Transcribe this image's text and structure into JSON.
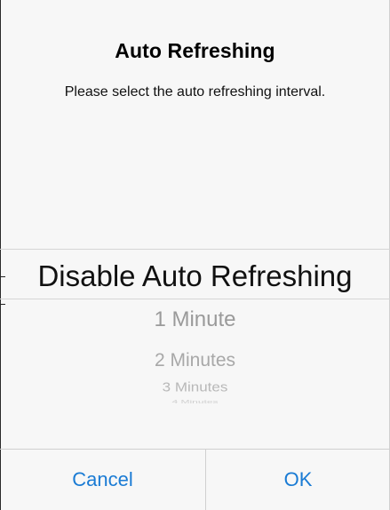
{
  "dialog": {
    "title": "Auto Refreshing",
    "message": "Please select the auto refreshing interval."
  },
  "picker": {
    "selected": "Disable Auto Refreshing",
    "options": [
      "1 Minute",
      "2 Minutes",
      "3 Minutes",
      "4 Minutes"
    ]
  },
  "buttons": {
    "cancel": "Cancel",
    "ok": "OK"
  },
  "colors": {
    "accent": "#1a7bd4",
    "background": "#f7f7f7",
    "divider": "#cfcfcf"
  }
}
